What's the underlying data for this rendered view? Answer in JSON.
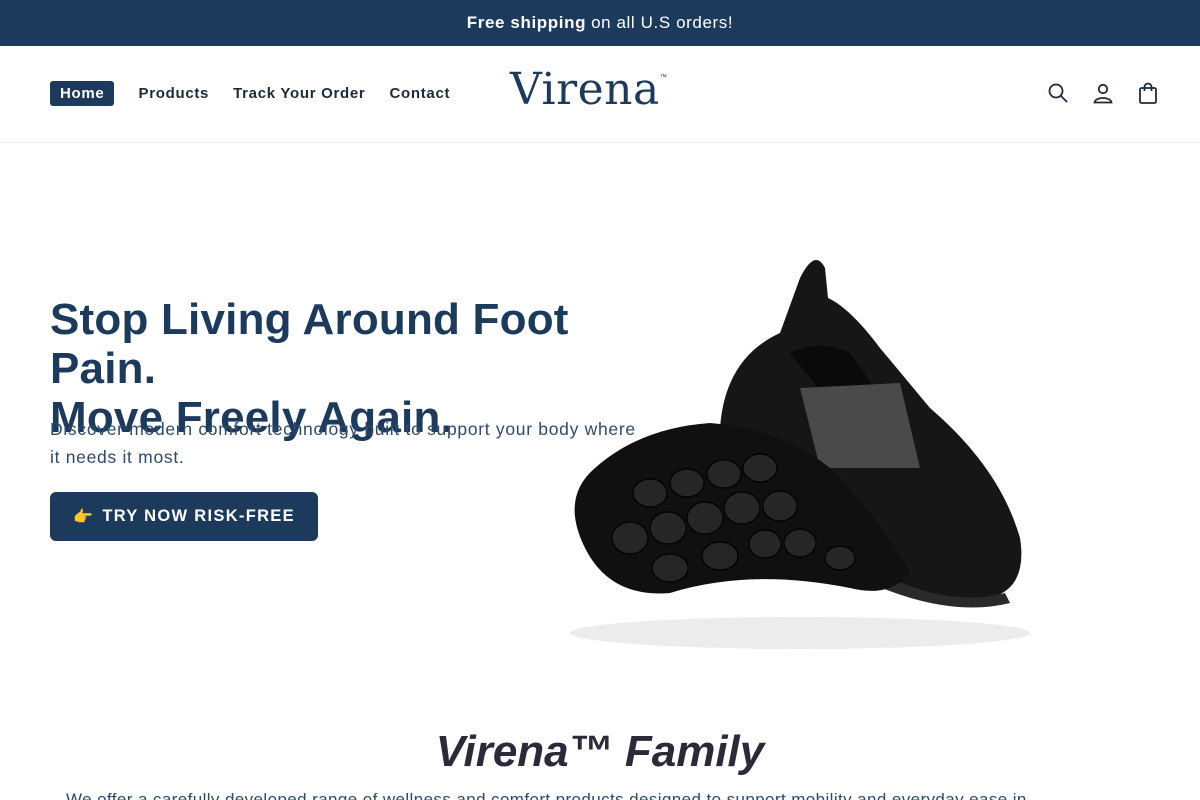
{
  "announcement": {
    "bold": "Free shipping",
    "rest": "on all U.S orders!"
  },
  "nav": {
    "items": [
      {
        "label": "Home",
        "active": true
      },
      {
        "label": "Products"
      },
      {
        "label": "Track Your Order"
      },
      {
        "label": "Contact"
      }
    ]
  },
  "brand": {
    "name": "Virena",
    "mark": "™"
  },
  "header_icons": [
    "search-icon",
    "account-icon",
    "cart-icon"
  ],
  "hero": {
    "headline_line1": "Stop Living Around Foot Pain.",
    "headline_line2": "Move Freely Again.",
    "subtext": "Discover modern comfort technology built to support your body where it needs it most.",
    "cta_emoji": "👉",
    "cta_label": "TRY NOW RISK-FREE",
    "image_alt": "black-slip-on-shoes"
  },
  "family": {
    "title": "Virena™ Family",
    "text": "We offer a carefully developed range of wellness and comfort products designed to support mobility and everyday ease in ..."
  },
  "colors": {
    "primary": "#1b3a5c",
    "text_dark": "#1e2a38",
    "white": "#ffffff"
  }
}
